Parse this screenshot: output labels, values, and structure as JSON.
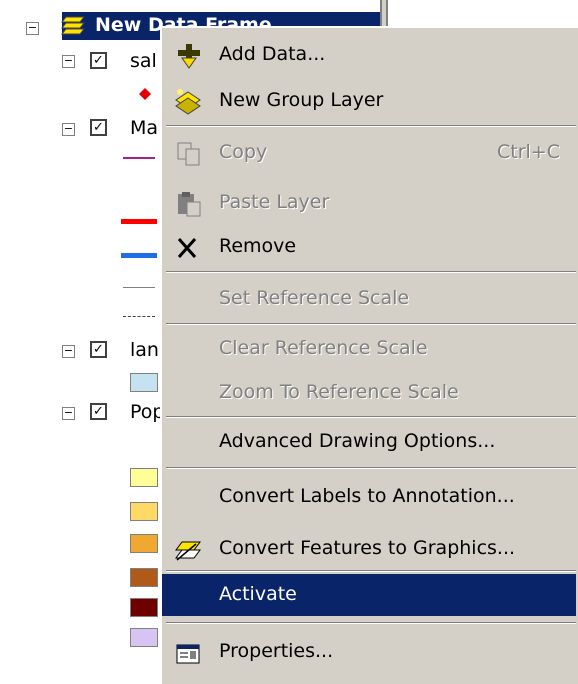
{
  "toc": {
    "data_frame": {
      "title": "New Data Frame"
    },
    "layers": [
      {
        "label": "sal"
      },
      {
        "label": "Ma"
      },
      {
        "label": "lan"
      },
      {
        "label": "Pop"
      }
    ]
  },
  "context_menu": {
    "items": [
      {
        "label": "Add Data...",
        "icon": "add-data-icon",
        "enabled": true
      },
      {
        "label": "New Group Layer",
        "icon": "group-layer-icon",
        "enabled": true
      },
      {
        "label": "Copy",
        "shortcut": "Ctrl+C",
        "icon": "copy-icon",
        "enabled": false
      },
      {
        "label": "Paste Layer",
        "icon": "paste-icon",
        "enabled": false
      },
      {
        "label": "Remove",
        "icon": "remove-icon",
        "enabled": true
      },
      {
        "label": "Set Reference Scale",
        "enabled": false
      },
      {
        "label": "Clear Reference Scale",
        "enabled": false
      },
      {
        "label": "Zoom To Reference Scale",
        "enabled": false
      },
      {
        "label": "Advanced Drawing Options...",
        "enabled": true
      },
      {
        "label": "Convert Labels to Annotation...",
        "enabled": true
      },
      {
        "label": "Convert Features to Graphics...",
        "icon": "convert-graphics-icon",
        "enabled": true
      },
      {
        "label": "Activate",
        "enabled": true,
        "highlighted": true
      },
      {
        "label": "Properties...",
        "icon": "properties-icon",
        "enabled": true
      }
    ]
  },
  "colors": {
    "menu_bg": "#d4d0c8",
    "highlight": "#0a246a",
    "disabled_text": "#808080",
    "line_magenta": "#a0208c",
    "line_red": "#ff0000",
    "line_blue": "#1e6ee6",
    "swatch_lightblue": "#c6e2f2",
    "pop_ramp": [
      "#ffff99",
      "#ffd966",
      "#f0a830",
      "#b05a1a",
      "#6e0000",
      "#d8c4f2"
    ]
  }
}
